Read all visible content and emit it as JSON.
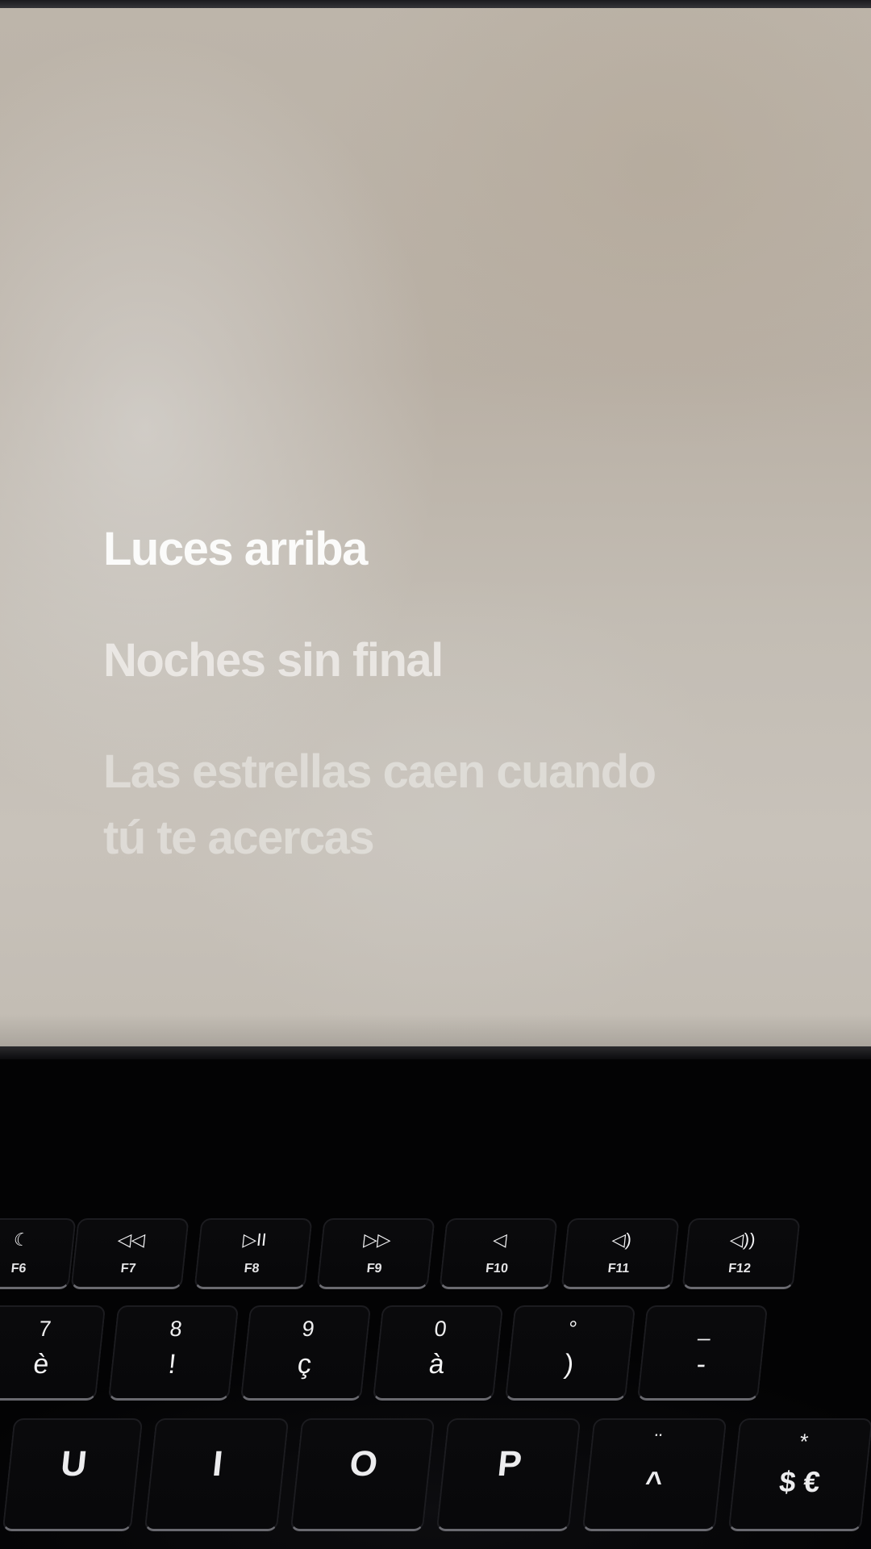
{
  "lyrics": {
    "active_line": "Luces arriba",
    "next_line": "Noches sin final",
    "later_line_1": "Las estrellas caen cuando",
    "later_line_2": "tú te acercas"
  },
  "keyboard": {
    "function_row": [
      {
        "label": "F6",
        "icon": "moon-icon",
        "glyph": "☾"
      },
      {
        "label": "F7",
        "icon": "rewind-icon",
        "glyph": "◁◁"
      },
      {
        "label": "F8",
        "icon": "play-pause-icon",
        "glyph": "▷II"
      },
      {
        "label": "F9",
        "icon": "fast-forward-icon",
        "glyph": "▷▷"
      },
      {
        "label": "F10",
        "icon": "mute-icon",
        "glyph": "◁"
      },
      {
        "label": "F11",
        "icon": "volume-down-icon",
        "glyph": "◁)"
      },
      {
        "label": "F12",
        "icon": "volume-up-icon",
        "glyph": "◁))"
      }
    ],
    "number_row": [
      {
        "top": "7",
        "bottom": "è"
      },
      {
        "top": "8",
        "bottom": "!"
      },
      {
        "top": "9",
        "bottom": "ç"
      },
      {
        "top": "0",
        "bottom": "à"
      },
      {
        "top": "°",
        "bottom": ")"
      },
      {
        "top": "_",
        "bottom": "-"
      }
    ],
    "letter_row": [
      {
        "letter": "U"
      },
      {
        "letter": "I"
      },
      {
        "letter": "O"
      },
      {
        "letter": "P"
      },
      {
        "top": "¨",
        "letter": "^"
      },
      {
        "top": "*",
        "letter": "$ €"
      }
    ]
  }
}
